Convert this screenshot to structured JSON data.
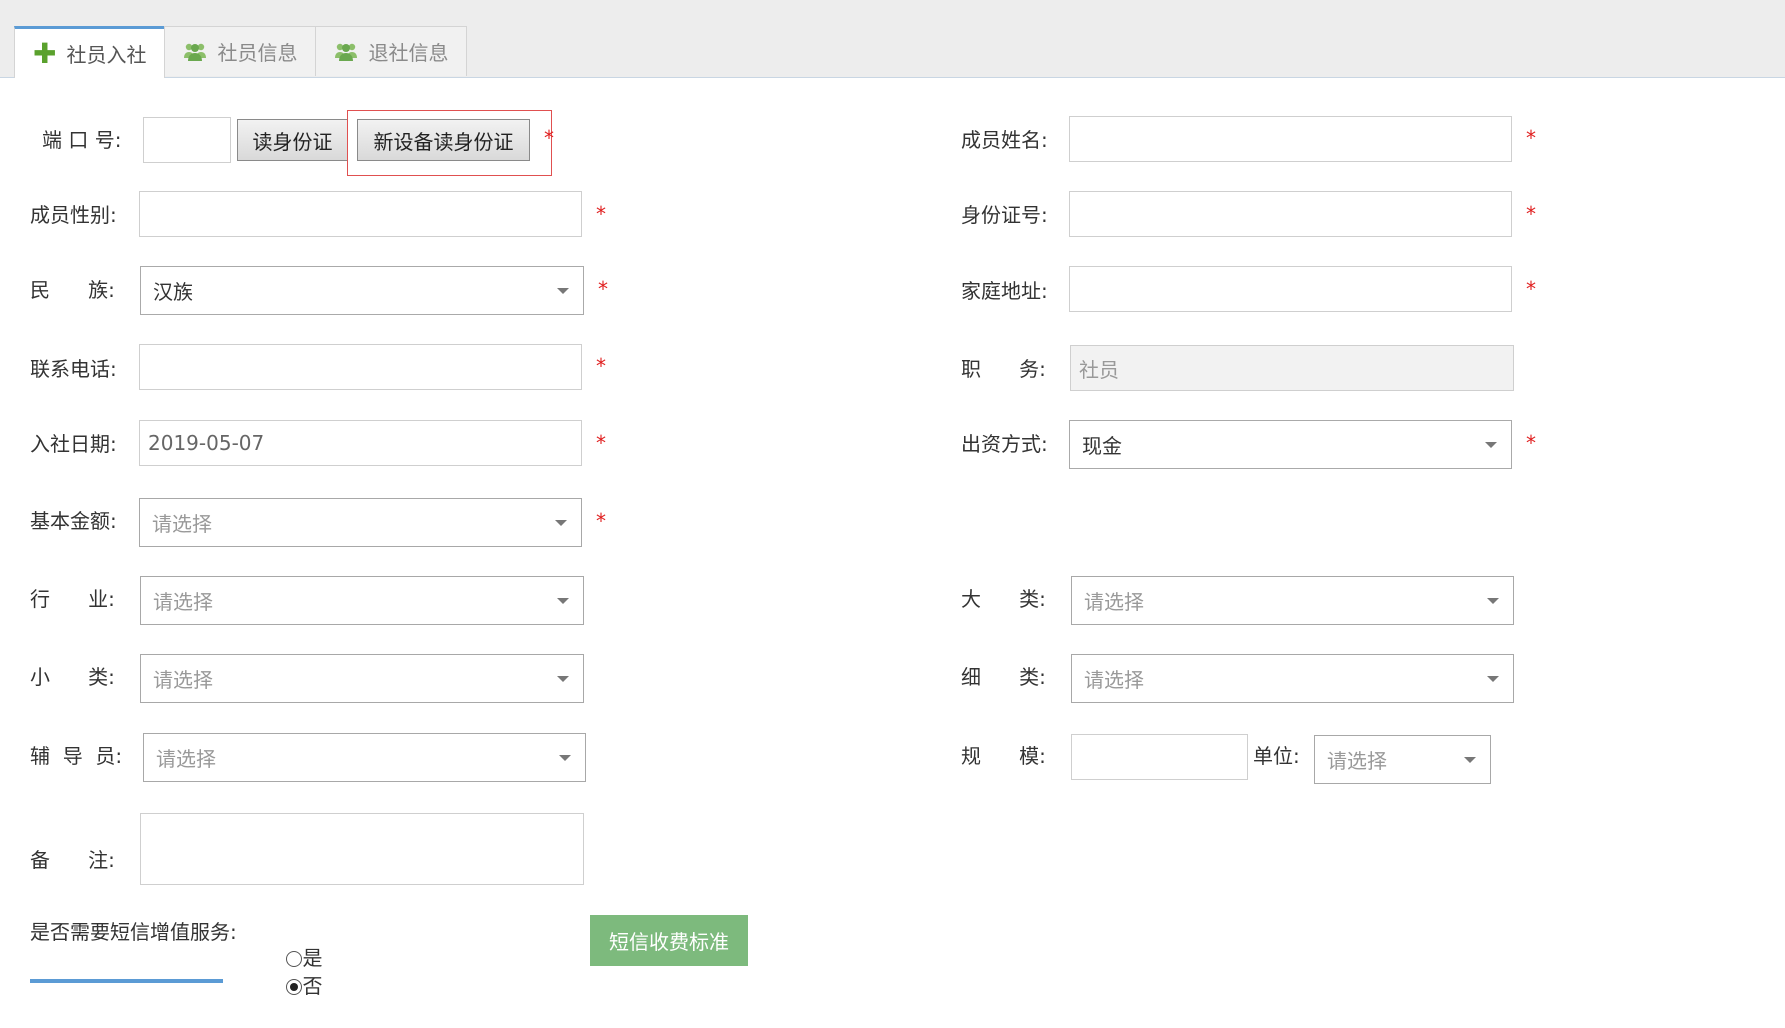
{
  "tabs": [
    {
      "label": "社员入社",
      "icon": "plus-icon"
    },
    {
      "label": "社员信息",
      "icon": "users-icon"
    },
    {
      "label": "退社信息",
      "icon": "users-icon"
    }
  ],
  "colors": {
    "accent": "#5b9bd5",
    "required": "#e02020",
    "icon_green": "#5aa12d",
    "sms_button": "#7dba7d"
  },
  "form": {
    "port": {
      "label": "端 口 号:",
      "value": ""
    },
    "read_id_button": "读身份证",
    "new_device_read_id_button": "新设备读身份证",
    "required_mark": "*",
    "name": {
      "label": "成员姓名:",
      "value": ""
    },
    "gender": {
      "label": "成员性别:",
      "value": ""
    },
    "id_number": {
      "label": "身份证号:",
      "value": ""
    },
    "ethnicity": {
      "label": "民      族:",
      "value": "汉族"
    },
    "address": {
      "label": "家庭地址:",
      "value": ""
    },
    "phone": {
      "label": "联系电话:",
      "value": ""
    },
    "position": {
      "label": "职      务:",
      "value": "社员"
    },
    "join_date": {
      "label": "入社日期:",
      "value": "2019-05-07"
    },
    "funding_method": {
      "label": "出资方式:",
      "value": "现金"
    },
    "base_amount": {
      "label": "基本金额:",
      "placeholder": "请选择"
    },
    "industry": {
      "label": "行      业:",
      "placeholder": "请选择"
    },
    "major_category": {
      "label": "大      类:",
      "placeholder": "请选择"
    },
    "minor_category": {
      "label": "小      类:",
      "placeholder": "请选择"
    },
    "sub_category": {
      "label": "细      类:",
      "placeholder": "请选择"
    },
    "counselor": {
      "label": "辅  导  员:",
      "placeholder": "请选择"
    },
    "scale": {
      "label": "规      模:",
      "value": ""
    },
    "unit": {
      "label": "单位:",
      "placeholder": "请选择"
    },
    "remarks": {
      "label": "备      注:",
      "value": ""
    },
    "sms_service": {
      "label": "是否需要短信增值服务:",
      "yes": "是",
      "no": "否",
      "selected": "否"
    },
    "sms_fee_button": "短信收费标准"
  }
}
